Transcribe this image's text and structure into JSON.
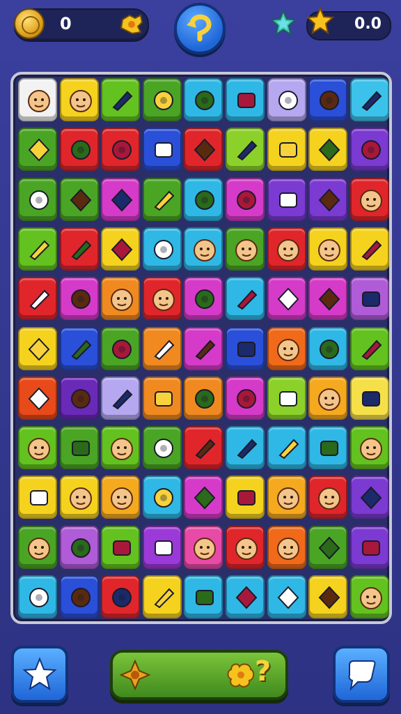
{
  "header": {
    "coins": "0",
    "stars": "0.0",
    "icons": {
      "coin": "coin-icon",
      "coin_badge": "puzzle-badge-icon",
      "undo": "undo-arrow-icon",
      "gem_star": "gem-star-icon",
      "gold_star": "gold-star-icon"
    }
  },
  "board": {
    "rows": 11,
    "cols": 9,
    "tiles": [
      [
        {
          "color": "#f2f2f2",
          "icon": "face-glasses"
        },
        {
          "color": "#f5d21e",
          "icon": "face-cap"
        },
        {
          "color": "#63c21f",
          "icon": "smile-green"
        },
        {
          "color": "#4aa525",
          "icon": "jar"
        },
        {
          "color": "#2fb8e6",
          "icon": "puzzle-yellow"
        },
        {
          "color": "#2fb8e6",
          "icon": "robot-head"
        },
        {
          "color": "#b5a8f0",
          "icon": "wrench"
        },
        {
          "color": "#2a4fd8",
          "icon": "gold-splat"
        },
        {
          "color": "#3cc2ea",
          "icon": "cross-bones"
        }
      ],
      [
        {
          "color": "#4aa525",
          "icon": "tiles-stack"
        },
        {
          "color": "#e0262b",
          "icon": "spiral"
        },
        {
          "color": "#e0262b",
          "icon": "spiral"
        },
        {
          "color": "#2a4fd8",
          "icon": "paint-roller"
        },
        {
          "color": "#e0262b",
          "icon": "scissors"
        },
        {
          "color": "#8bd12a",
          "icon": "ticket"
        },
        {
          "color": "#f5d21e",
          "icon": "monitor"
        },
        {
          "color": "#f5d21e",
          "icon": "purple-blob"
        },
        {
          "color": "#7b3ad1",
          "icon": "feather"
        }
      ],
      [
        {
          "color": "#4aa525",
          "icon": "box"
        },
        {
          "color": "#4aa525",
          "icon": "book-open"
        },
        {
          "color": "#d53bc8",
          "icon": "fruit"
        },
        {
          "color": "#4aa525",
          "icon": "pencil"
        },
        {
          "color": "#2fb8e6",
          "icon": "cookie"
        },
        {
          "color": "#d53bc8",
          "icon": "blob-yellow"
        },
        {
          "color": "#7b3ad1",
          "icon": "puzzle-piece"
        },
        {
          "color": "#7b3ad1",
          "icon": "pen"
        },
        {
          "color": "#e0262b",
          "icon": "face-plain"
        }
      ],
      [
        {
          "color": "#63c21f",
          "icon": "stripe-ball"
        },
        {
          "color": "#e0262b",
          "icon": "screwdriver"
        },
        {
          "color": "#f5d21e",
          "icon": "cat-face"
        },
        {
          "color": "#2fb8e6",
          "icon": "red-gem"
        },
        {
          "color": "#2fb8e6",
          "icon": "face-green"
        },
        {
          "color": "#4aa525",
          "icon": "face-helmet"
        },
        {
          "color": "#e0262b",
          "icon": "face-brown"
        },
        {
          "color": "#f5d21e",
          "icon": "face-orange"
        },
        {
          "color": "#f5d21e",
          "icon": "leaf-badge"
        }
      ],
      [
        {
          "color": "#e0262b",
          "icon": "key"
        },
        {
          "color": "#d53bc8",
          "icon": "eye-mask"
        },
        {
          "color": "#f08a20",
          "icon": "face-glasses"
        },
        {
          "color": "#e0262b",
          "icon": "face-blue"
        },
        {
          "color": "#d53bc8",
          "icon": "green-blob"
        },
        {
          "color": "#2fb8e6",
          "icon": "bell"
        },
        {
          "color": "#d53bc8",
          "icon": "card"
        },
        {
          "color": "#d53bc8",
          "icon": "gear-box"
        },
        {
          "color": "#b05cd8",
          "icon": "lamp"
        }
      ],
      [
        {
          "color": "#f5d21e",
          "icon": "eraser"
        },
        {
          "color": "#2a4fd8",
          "icon": "orange-star"
        },
        {
          "color": "#4aa525",
          "icon": "screen"
        },
        {
          "color": "#f08a20",
          "icon": "rose"
        },
        {
          "color": "#d53bc8",
          "icon": "medal"
        },
        {
          "color": "#2a4fd8",
          "icon": "spiral-orange"
        },
        {
          "color": "#f06a1a",
          "icon": "face-orange"
        },
        {
          "color": "#2fb8e6",
          "icon": "screen"
        },
        {
          "color": "#63c21f",
          "icon": "magnifier"
        }
      ],
      [
        {
          "color": "#e84a1a",
          "icon": "square-white"
        },
        {
          "color": "#6a2ab8",
          "icon": "bag"
        },
        {
          "color": "#b5a8f0",
          "icon": "gameboy"
        },
        {
          "color": "#f08a20",
          "icon": "bubble"
        },
        {
          "color": "#f08a20",
          "icon": "eraser-green"
        },
        {
          "color": "#d53bc8",
          "icon": "cloud-blob"
        },
        {
          "color": "#8bd12a",
          "icon": "leaf"
        },
        {
          "color": "#f5a91e",
          "icon": "face-box"
        },
        {
          "color": "#f5e04a",
          "icon": "globe"
        }
      ],
      [
        {
          "color": "#63c21f",
          "icon": "face-glasses"
        },
        {
          "color": "#4aa525",
          "icon": "chili"
        },
        {
          "color": "#63c21f",
          "icon": "face-brown"
        },
        {
          "color": "#4aa525",
          "icon": "calculator"
        },
        {
          "color": "#e0262b",
          "icon": "target"
        },
        {
          "color": "#2fb8e6",
          "icon": "compass"
        },
        {
          "color": "#2fb8e6",
          "icon": "parrot"
        },
        {
          "color": "#2fb8e6",
          "icon": "star-spin"
        },
        {
          "color": "#63c21f",
          "icon": "face-yellow"
        }
      ],
      [
        {
          "color": "#f5d21e",
          "icon": "basket"
        },
        {
          "color": "#f5d21e",
          "icon": "face-orange"
        },
        {
          "color": "#f5a91e",
          "icon": "face-orange"
        },
        {
          "color": "#2fb8e6",
          "icon": "balloon"
        },
        {
          "color": "#d53bc8",
          "icon": "butterfly"
        },
        {
          "color": "#f5d21e",
          "icon": "map"
        },
        {
          "color": "#f5a91e",
          "icon": "face-box"
        },
        {
          "color": "#e0262b",
          "icon": "face-plain"
        },
        {
          "color": "#7b3ad1",
          "icon": "bag-white"
        }
      ],
      [
        {
          "color": "#4aa525",
          "icon": "face-teal"
        },
        {
          "color": "#b05cd8",
          "icon": "shield"
        },
        {
          "color": "#63c21f",
          "icon": "link"
        },
        {
          "color": "#9b3ad8",
          "icon": "cloud"
        },
        {
          "color": "#e84aa8",
          "icon": "face-yellow"
        },
        {
          "color": "#e0262b",
          "icon": "face-yellow"
        },
        {
          "color": "#f06a1a",
          "icon": "face-orange"
        },
        {
          "color": "#4aa525",
          "icon": "radio"
        },
        {
          "color": "#7b3ad1",
          "icon": "spoon"
        }
      ],
      [
        {
          "color": "#2fb8e6",
          "icon": "leaf-blue"
        },
        {
          "color": "#2a4fd8",
          "icon": "house"
        },
        {
          "color": "#e0262b",
          "icon": "envelope"
        },
        {
          "color": "#f5d21e",
          "icon": "pencil"
        },
        {
          "color": "#2fb8e6",
          "icon": "candy"
        },
        {
          "color": "#2fb8e6",
          "icon": "calendar"
        },
        {
          "color": "#2fb8e6",
          "icon": "cherries"
        },
        {
          "color": "#f5d21e",
          "icon": "leaf-orange"
        },
        {
          "color": "#63c21f",
          "icon": "face-blue"
        }
      ]
    ]
  },
  "footer": {
    "left_icon": "star-icon",
    "right_icon": "speech-bubble-icon",
    "hint_left_icon": "compass-emblem-icon",
    "hint_right_icon": "puzzle-cookie-icon",
    "hint_text": "?"
  }
}
